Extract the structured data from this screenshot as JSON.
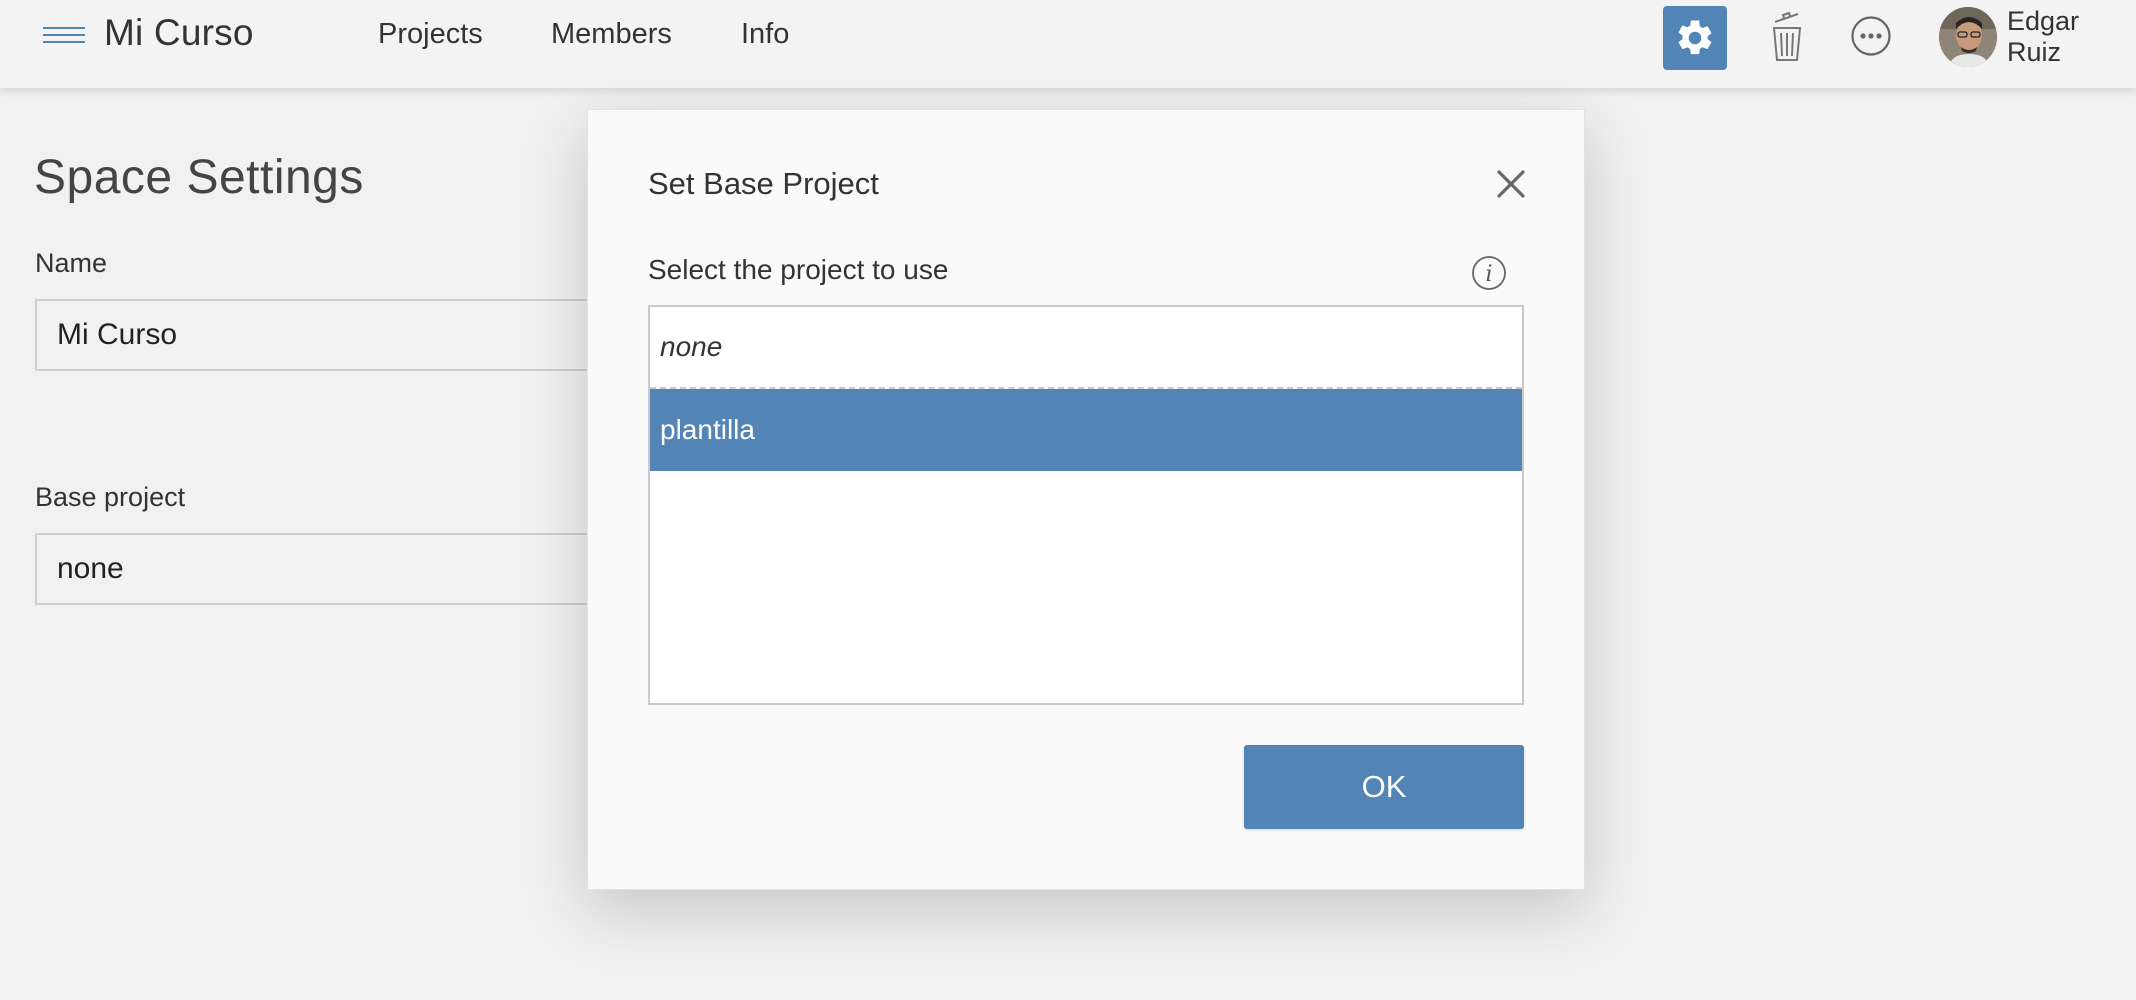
{
  "topbar": {
    "space_title": "Mi Curso",
    "nav": [
      "Projects",
      "Members",
      "Info"
    ],
    "user_name": "Edgar Ruiz",
    "accent": "#5384b6"
  },
  "settings": {
    "page_title": "Space Settings",
    "name_label": "Name",
    "name_value": "Mi Curso",
    "base_label": "Base project",
    "base_value": "none"
  },
  "modal": {
    "title": "Set Base Project",
    "select_label": "Select the project to use",
    "options": [
      "none",
      "plantilla"
    ],
    "selected_option": "plantilla",
    "ok_label": "OK"
  }
}
